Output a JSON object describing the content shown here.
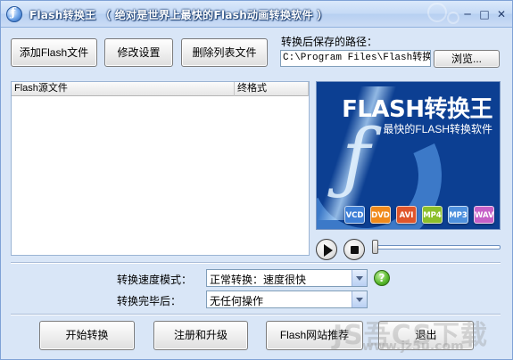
{
  "window": {
    "title": "Flash转换王 （ 绝对是世界上最快的Flash动画转换软件 ）",
    "minimize_glyph": "─",
    "maximize_glyph": "□",
    "close_glyph": "✕"
  },
  "toolbar": {
    "add_label": "添加Flash文件",
    "settings_label": "修改设置",
    "delete_label": "删除列表文件"
  },
  "output": {
    "label": "转换后保存的路径：",
    "path": "C:\\Program Files\\Flash转换王",
    "browse_label": "浏览..."
  },
  "file_list": {
    "columns": [
      "Flash源文件",
      "终格式"
    ]
  },
  "banner": {
    "title": "FLASH转换王",
    "subtitle": "最快的FLASH转换软件",
    "formats": [
      {
        "label": "VCD",
        "color": "#3e7fd6"
      },
      {
        "label": "DVD",
        "color": "#f08a1c"
      },
      {
        "label": "AVI",
        "color": "#e0552b"
      },
      {
        "label": "MP4",
        "color": "#8cbf2a"
      },
      {
        "label": "MP3",
        "color": "#4e90dd"
      },
      {
        "label": "WAV",
        "color": "#c660c7"
      }
    ]
  },
  "player": {
    "progress": 0
  },
  "options": {
    "speed_label": "转换速度模式：",
    "speed_value": "正常转换：速度很快",
    "after_label": "转换完毕后：",
    "after_value": "无任何操作",
    "help_glyph": "?"
  },
  "actions": {
    "start_label": "开始转换",
    "register_label": "注册和升级",
    "recommend_label": "Flash网站推荐",
    "exit_label": "退出"
  },
  "watermark": {
    "line1": "JS吾CS下载",
    "line2": "www.jz5u.com"
  }
}
